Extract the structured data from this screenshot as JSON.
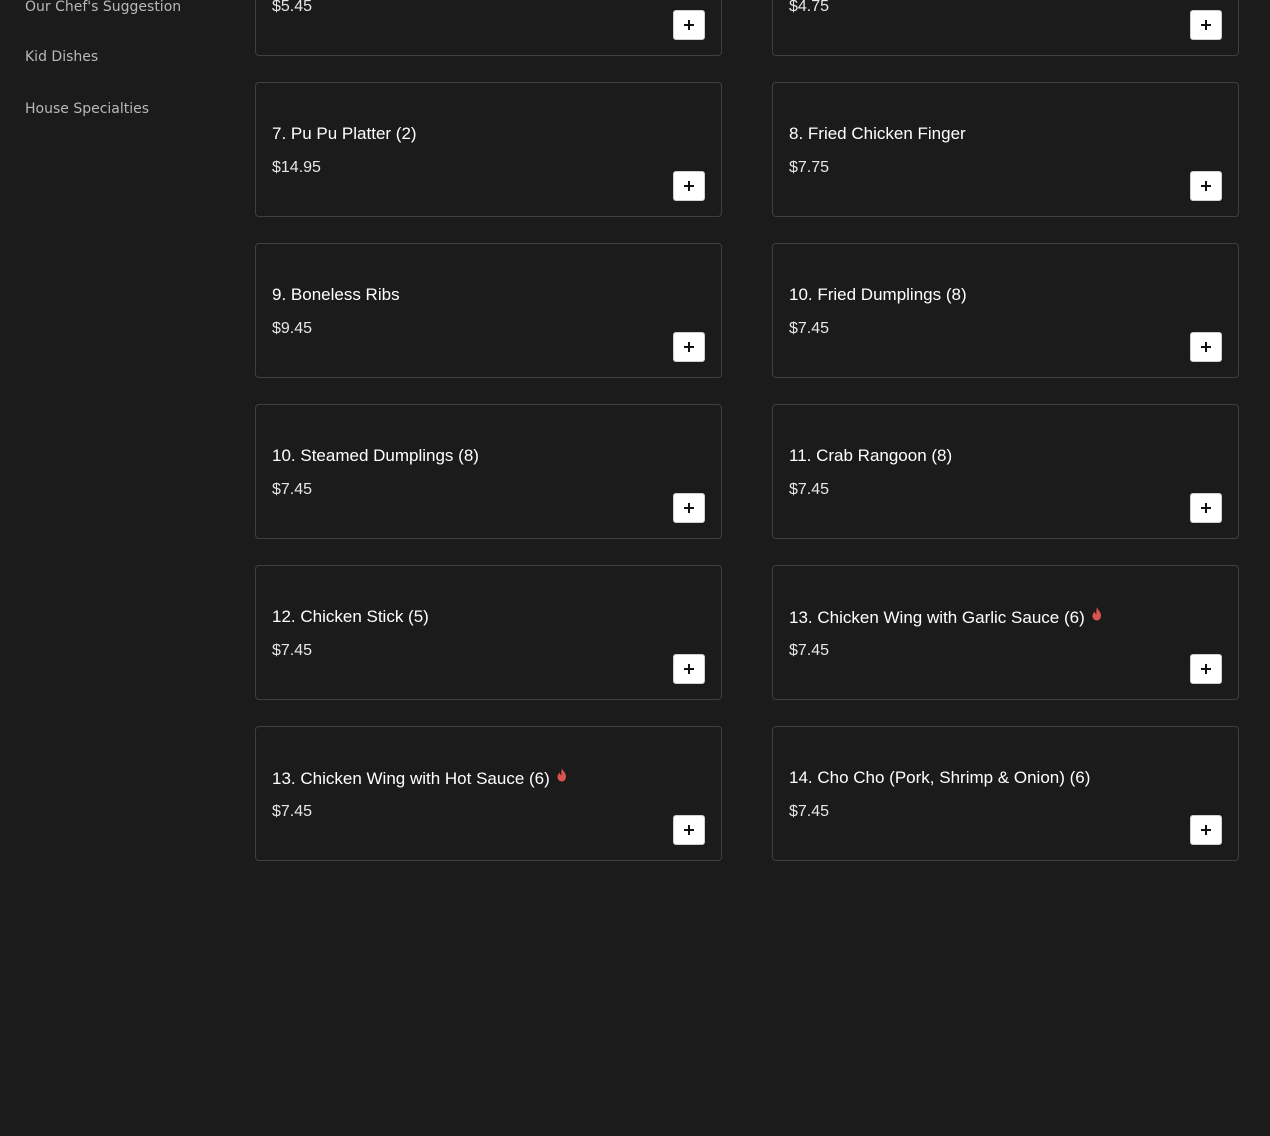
{
  "sidebar": {
    "items": [
      {
        "label": "Our Chef's Suggestion"
      },
      {
        "label": "Kid Dishes"
      },
      {
        "label": "House Specialties"
      }
    ]
  },
  "menu": {
    "items": [
      {
        "title": "",
        "price": "$5.45",
        "spicy": false
      },
      {
        "title": "",
        "price": "$4.75",
        "spicy": false
      },
      {
        "title": "7. Pu Pu Platter (2)",
        "price": "$14.95",
        "spicy": false
      },
      {
        "title": "8. Fried Chicken Finger",
        "price": "$7.75",
        "spicy": false
      },
      {
        "title": "9. Boneless Ribs",
        "price": "$9.45",
        "spicy": false
      },
      {
        "title": "10. Fried Dumplings (8)",
        "price": "$7.45",
        "spicy": false
      },
      {
        "title": "10. Steamed Dumplings (8)",
        "price": "$7.45",
        "spicy": false
      },
      {
        "title": "11. Crab Rangoon (8)",
        "price": "$7.45",
        "spicy": false
      },
      {
        "title": "12. Chicken Stick (5)",
        "price": "$7.45",
        "spicy": false
      },
      {
        "title": "13. Chicken Wing with Garlic Sauce (6)",
        "price": "$7.45",
        "spicy": true
      },
      {
        "title": "13. Chicken Wing with Hot Sauce (6)",
        "price": "$7.45",
        "spicy": true
      },
      {
        "title": "14. Cho Cho (Pork, Shrimp & Onion) (6)",
        "price": "$7.45",
        "spicy": false
      }
    ]
  },
  "icons": {
    "add": "plus-icon",
    "spicy": "fire-icon"
  },
  "colors": {
    "background": "#1b1b1b",
    "card_border": "#3f3f3f",
    "spicy": "#d9534f",
    "button_bg": "#ffffff"
  }
}
